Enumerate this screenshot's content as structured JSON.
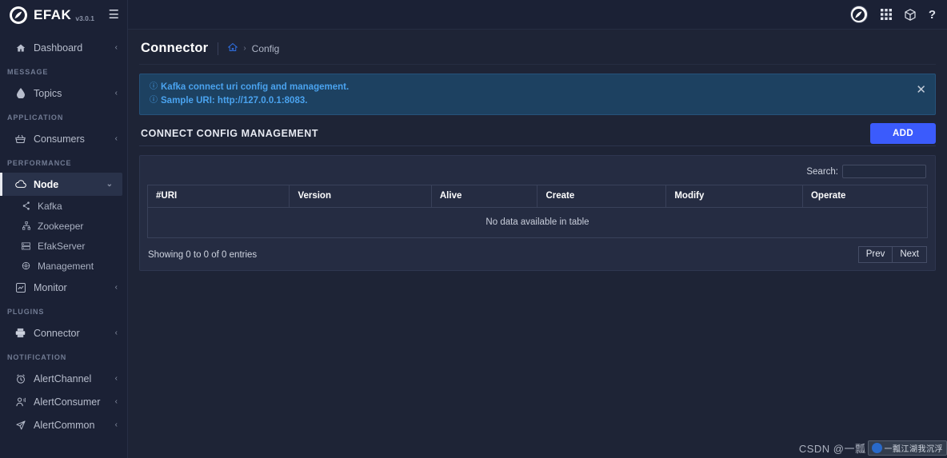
{
  "brand": {
    "name": "EFAK",
    "version": "v3.0.1",
    "logo_icon": "feather-logo-icon",
    "menu_icon": "hamburger-menu-icon"
  },
  "topbar": {
    "icons": [
      {
        "name": "user-avatar",
        "glyph": "feather"
      },
      {
        "name": "grid-apps-icon",
        "glyph": "▦"
      },
      {
        "name": "cube-icon",
        "glyph": "⬡"
      },
      {
        "name": "help-icon",
        "glyph": "?"
      }
    ]
  },
  "sidebar": {
    "groups": [
      {
        "title": "",
        "items": [
          {
            "label": "Dashboard",
            "icon": "home-icon",
            "glyph": "⌂",
            "chevron": "‹",
            "active": false
          }
        ]
      },
      {
        "title": "MESSAGE",
        "items": [
          {
            "label": "Topics",
            "icon": "droplet-icon",
            "glyph": "◗",
            "chevron": "‹",
            "active": false
          }
        ]
      },
      {
        "title": "APPLICATION",
        "items": [
          {
            "label": "Consumers",
            "icon": "basket-icon",
            "glyph": "⛃",
            "chevron": "‹",
            "active": false
          }
        ]
      },
      {
        "title": "PERFORMANCE",
        "items": [
          {
            "label": "Node",
            "icon": "cloud-icon",
            "glyph": "☁",
            "chevron": "⌄",
            "active": true
          }
        ],
        "subitems": [
          {
            "label": "Kafka",
            "icon": "share-nodes-icon",
            "glyph": "⑃"
          },
          {
            "label": "Zookeeper",
            "icon": "sitemap-icon",
            "glyph": "⚘"
          },
          {
            "label": "EfakServer",
            "icon": "server-icon",
            "glyph": "▤"
          },
          {
            "label": "Management",
            "icon": "gear-icon",
            "glyph": "⚙"
          }
        ],
        "trailing": [
          {
            "label": "Monitor",
            "icon": "chart-box-icon",
            "glyph": "▣",
            "chevron": "‹",
            "active": false
          }
        ]
      },
      {
        "title": "PLUGINS",
        "items": [
          {
            "label": "Connector",
            "icon": "printer-icon",
            "glyph": "⎙",
            "chevron": "‹",
            "active": false
          }
        ]
      },
      {
        "title": "NOTIFICATION",
        "items": [
          {
            "label": "AlertChannel",
            "icon": "alarm-clock-icon",
            "glyph": "⏰",
            "chevron": "‹",
            "active": false
          },
          {
            "label": "AlertConsumer",
            "icon": "user-alert-icon",
            "glyph": "⚇",
            "chevron": "‹",
            "active": false
          },
          {
            "label": "AlertCommon",
            "icon": "send-icon",
            "glyph": "➤",
            "chevron": "‹",
            "active": false
          }
        ]
      }
    ]
  },
  "page": {
    "title": "Connector",
    "breadcrumb": {
      "home_icon": "home-icon",
      "separator": "›",
      "current": "Config"
    }
  },
  "alert": {
    "line1": "Kafka connect uri config and management.",
    "line2": "Sample URI: http://127.0.0.1:8083.",
    "info_icon": "info-circle-icon",
    "close_icon": "close-icon",
    "accent_color": "#4aa3ef",
    "background_color": "#1d4161"
  },
  "section": {
    "title": "CONNECT CONFIG MANAGEMENT",
    "add_label": "ADD",
    "add_color": "#3b5bfc"
  },
  "table": {
    "search_label": "Search:",
    "search_value": "",
    "search_placeholder": "",
    "columns": [
      "#URI",
      "Version",
      "Alive",
      "Create",
      "Modify",
      "Operate"
    ],
    "rows": [],
    "empty_message": "No data available in table",
    "showing": "Showing 0 to 0 of 0 entries",
    "prev_label": "Prev",
    "next_label": "Next"
  },
  "watermark": {
    "text": "CSDN @一瓢",
    "badge": "一瓢江湖我沉浮"
  }
}
